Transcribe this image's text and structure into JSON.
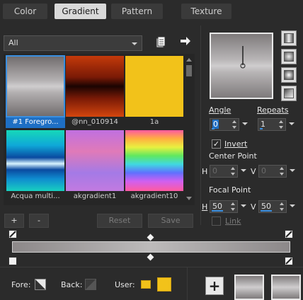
{
  "tabs": [
    {
      "label": "Color",
      "active": false
    },
    {
      "label": "Gradient",
      "active": true
    },
    {
      "label": "Pattern",
      "active": false
    },
    {
      "label": "Texture",
      "active": false
    }
  ],
  "filter": {
    "value": "All"
  },
  "gallery": {
    "items": [
      {
        "label": "#1 Foregro...",
        "selected": true,
        "swatch": "foreground-background"
      },
      {
        "label": "@nn_010914",
        "selected": false,
        "swatch": "red-black"
      },
      {
        "label": "1a",
        "selected": false,
        "swatch": "yellow"
      },
      {
        "label": "Acqua multi...",
        "selected": false,
        "swatch": "aqua"
      },
      {
        "label": "akgradient1",
        "selected": false,
        "swatch": "pink-purple"
      },
      {
        "label": "akgradient10",
        "selected": false,
        "swatch": "rainbow"
      }
    ]
  },
  "buttons": {
    "add": "+",
    "remove": "-",
    "reset": "Reset",
    "save": "Save",
    "add_swatch": "+"
  },
  "angle": {
    "label": "Angle",
    "value": "0"
  },
  "repeats": {
    "label": "Repeats",
    "value": "1"
  },
  "invert": {
    "label": "Invert",
    "checked": true
  },
  "center_point": {
    "label": "Center Point",
    "h_label": "H",
    "h_value": "0",
    "v_label": "V",
    "v_value": "0"
  },
  "focal_point": {
    "label": "Focal Point",
    "h_label": "H",
    "h_value": "50",
    "v_label": "V",
    "v_value": "50"
  },
  "link": {
    "label": "Link",
    "checked": false
  },
  "footer": {
    "fore_label": "Fore:",
    "back_label": "Back:",
    "user_label": "User:"
  },
  "colors": {
    "accent": "#1e6fc4",
    "user_swatch": "#f2c21a"
  }
}
